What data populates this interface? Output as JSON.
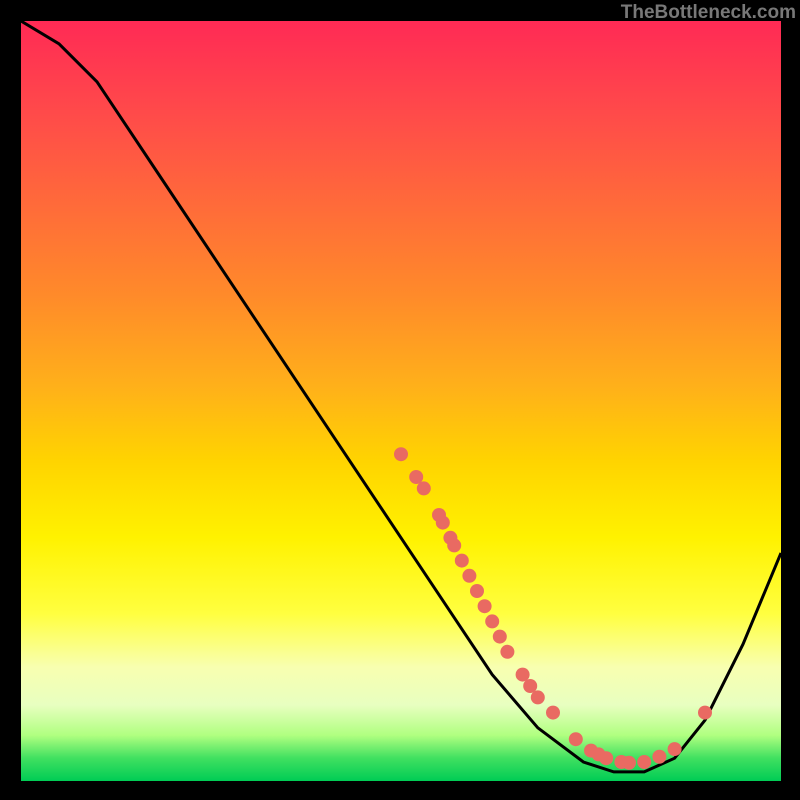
{
  "attribution": "TheBottleneck.com",
  "chart_data": {
    "type": "line",
    "title": "",
    "xlabel": "",
    "ylabel": "",
    "xlim": [
      0,
      100
    ],
    "ylim": [
      0,
      100
    ],
    "curve": [
      {
        "x": 0,
        "y": 100
      },
      {
        "x": 5,
        "y": 97
      },
      {
        "x": 10,
        "y": 92
      },
      {
        "x": 18,
        "y": 80
      },
      {
        "x": 30,
        "y": 62
      },
      {
        "x": 40,
        "y": 47
      },
      {
        "x": 50,
        "y": 32
      },
      {
        "x": 56,
        "y": 23
      },
      {
        "x": 62,
        "y": 14
      },
      {
        "x": 68,
        "y": 7
      },
      {
        "x": 74,
        "y": 2.5
      },
      {
        "x": 78,
        "y": 1.2
      },
      {
        "x": 82,
        "y": 1.2
      },
      {
        "x": 86,
        "y": 3
      },
      {
        "x": 90,
        "y": 8
      },
      {
        "x": 95,
        "y": 18
      },
      {
        "x": 100,
        "y": 30
      }
    ],
    "markers": [
      {
        "x": 50,
        "y": 43
      },
      {
        "x": 52,
        "y": 40
      },
      {
        "x": 53,
        "y": 38.5
      },
      {
        "x": 55,
        "y": 35
      },
      {
        "x": 55.5,
        "y": 34
      },
      {
        "x": 56.5,
        "y": 32
      },
      {
        "x": 57,
        "y": 31
      },
      {
        "x": 58,
        "y": 29
      },
      {
        "x": 59,
        "y": 27
      },
      {
        "x": 60,
        "y": 25
      },
      {
        "x": 61,
        "y": 23
      },
      {
        "x": 62,
        "y": 21
      },
      {
        "x": 63,
        "y": 19
      },
      {
        "x": 64,
        "y": 17
      },
      {
        "x": 66,
        "y": 14
      },
      {
        "x": 67,
        "y": 12.5
      },
      {
        "x": 68,
        "y": 11
      },
      {
        "x": 70,
        "y": 9
      },
      {
        "x": 73,
        "y": 5.5
      },
      {
        "x": 75,
        "y": 4
      },
      {
        "x": 76,
        "y": 3.5
      },
      {
        "x": 77,
        "y": 3
      },
      {
        "x": 79,
        "y": 2.5
      },
      {
        "x": 80,
        "y": 2.4
      },
      {
        "x": 82,
        "y": 2.5
      },
      {
        "x": 84,
        "y": 3.2
      },
      {
        "x": 86,
        "y": 4.2
      },
      {
        "x": 90,
        "y": 9
      }
    ],
    "marker_color": "#e96a62",
    "line_color": "#000000"
  }
}
